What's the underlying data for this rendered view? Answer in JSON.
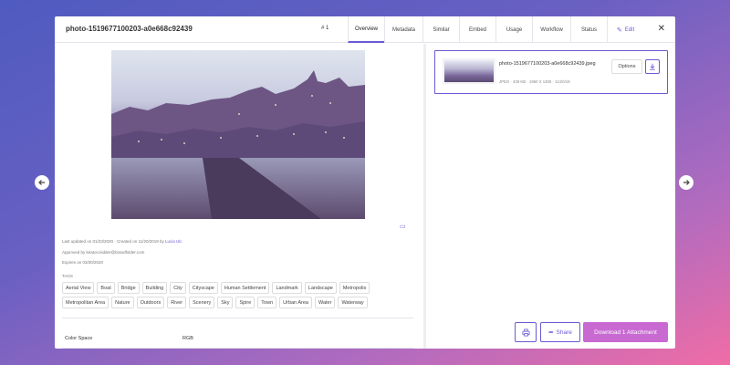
{
  "asset": {
    "title": "photo-1519677100203-a0e668c92439",
    "counter": "# 1"
  },
  "tabs": [
    {
      "label": "Overview",
      "active": true
    },
    {
      "label": "Metadata"
    },
    {
      "label": "Similar"
    },
    {
      "label": "Embed"
    },
    {
      "label": "Usage"
    },
    {
      "label": "Workflow"
    },
    {
      "label": "Status"
    },
    {
      "label": "Edit",
      "icon": "pencil-icon"
    }
  ],
  "meta": {
    "updated_prefix": "Last updated on 01/23/2020 · Created on 11/20/2019 by",
    "author": "Lucia Ulc",
    "approved": "Approved by keaton.kidder@brandfolder.com",
    "expires": "Expires on 03/30/2020"
  },
  "tags_label": "TAGS",
  "tags": [
    "Aerial View",
    "Boat",
    "Bridge",
    "Building",
    "City",
    "Cityscape",
    "Human Settlement",
    "Landmark",
    "Landscape",
    "Metropolis",
    "Metropolitan Area",
    "Nature",
    "Outdoors",
    "River",
    "Scenery",
    "Sky",
    "Spire",
    "Town",
    "Urban Area",
    "Water",
    "Waterway"
  ],
  "color_space": {
    "label": "Color Space",
    "value": "RGB"
  },
  "attachment": {
    "name": "photo-1519677100203-a0e668c92439.jpeg",
    "meta": "JPEG · 439 KB · 1950 X 1300 · 11/20/19",
    "options_label": "Options"
  },
  "footer": {
    "share_label": "Share",
    "download_label": "Download 1 Attachment"
  },
  "colors": {
    "accent": "#6a5ad5",
    "download_button": "#c96ad2"
  }
}
